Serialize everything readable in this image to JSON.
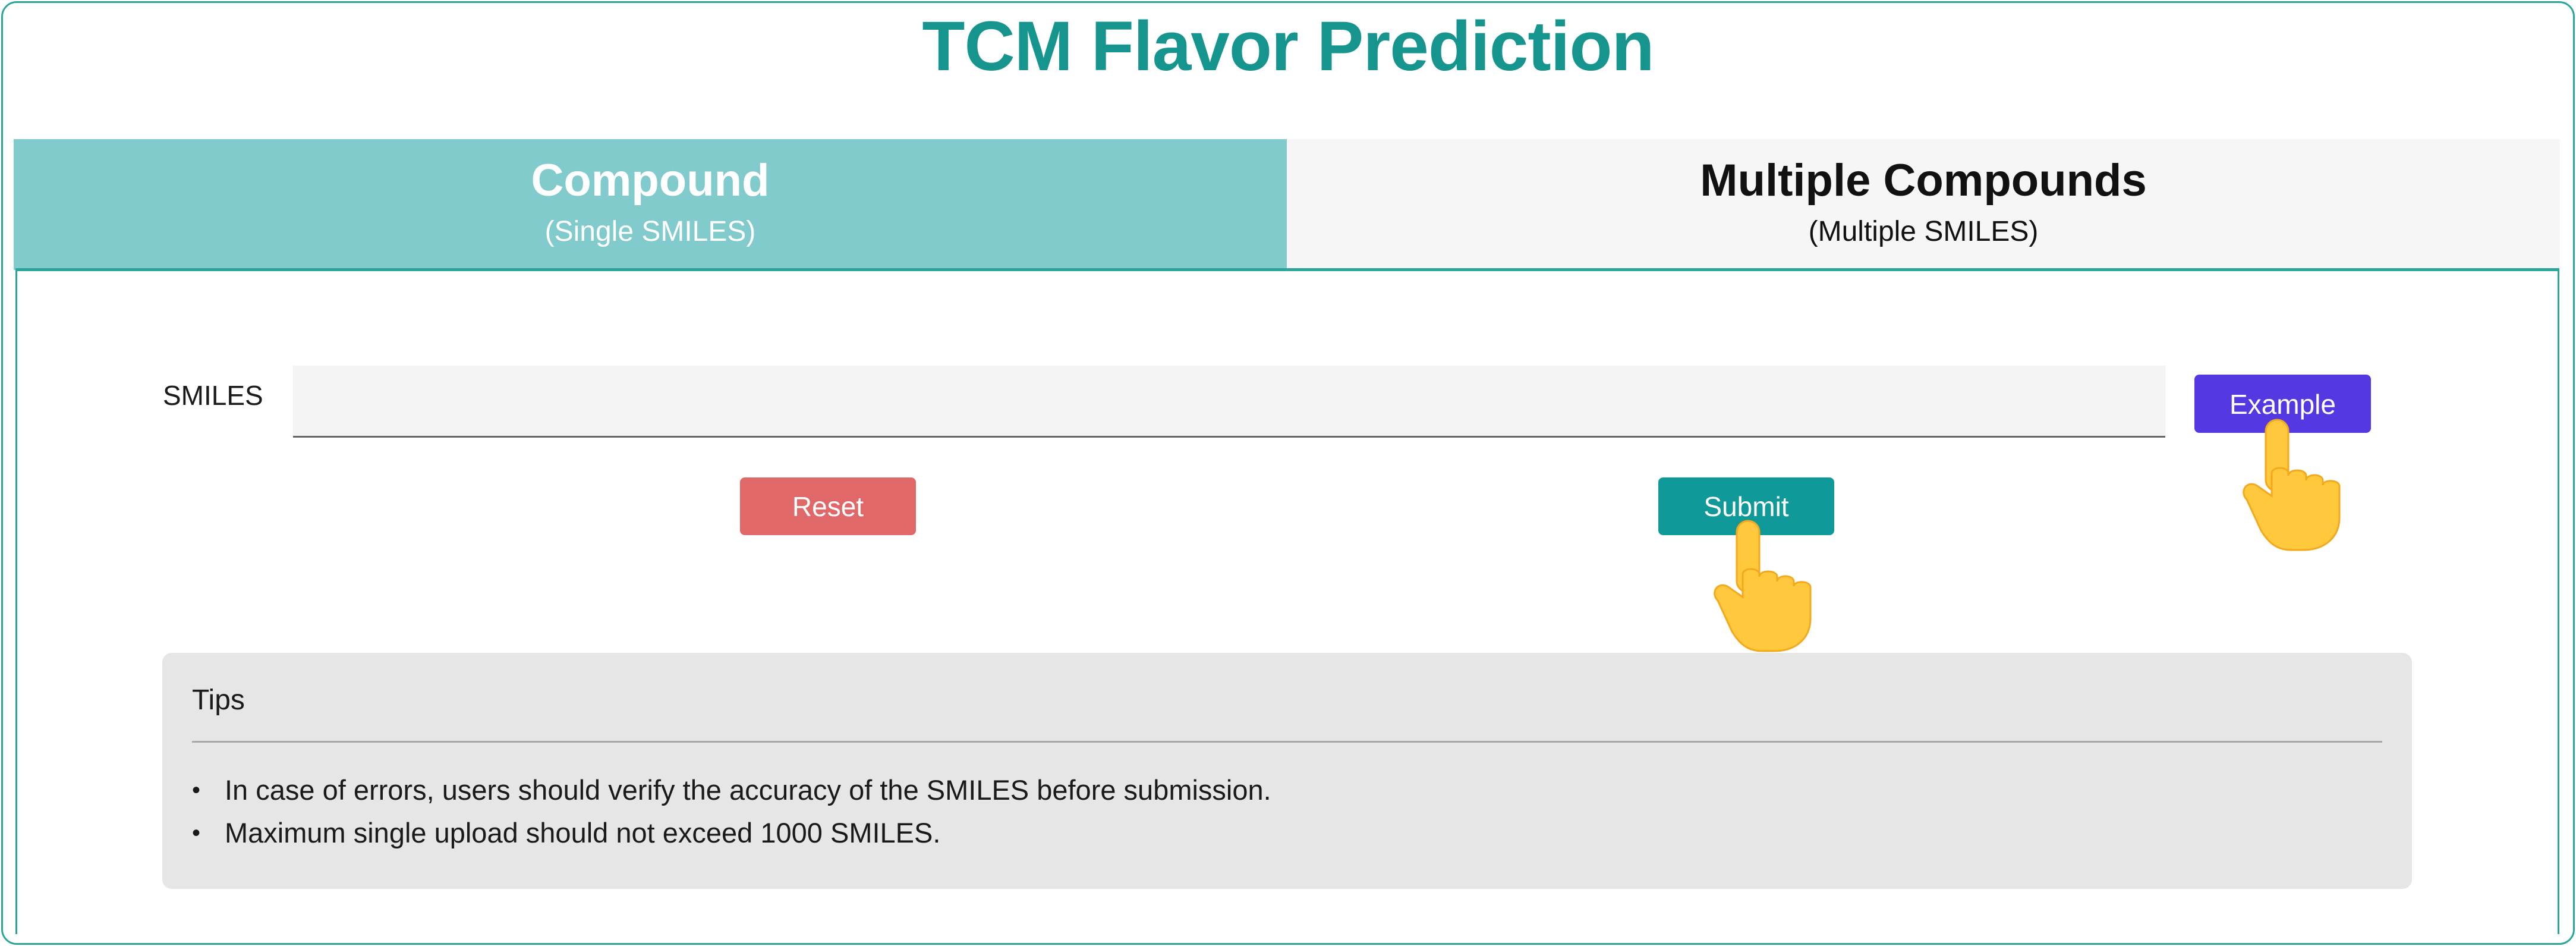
{
  "page": {
    "title": "TCM Flavor Prediction"
  },
  "tabs": [
    {
      "label": "Compound",
      "sublabel": "(Single SMILES)",
      "active": true
    },
    {
      "label": "Multiple Compounds",
      "sublabel": "(Multiple SMILES)",
      "active": false
    }
  ],
  "form": {
    "smiles_label": "SMILES",
    "smiles_value": "",
    "smiles_placeholder": "",
    "example_label": "Example",
    "reset_label": "Reset",
    "submit_label": "Submit"
  },
  "tips": {
    "title": "Tips",
    "items": [
      "In case of errors, users should verify the accuracy of the SMILES before submission.",
      "Maximum single upload should not exceed 1000 SMILES."
    ]
  },
  "icons": {
    "pointer": "pointing-hand-icon"
  },
  "colors": {
    "accent": "#16958f",
    "tab_active": "#82cbcc",
    "example_button": "#5439e3",
    "reset_button": "#e06868",
    "submit_button": "#0f9999",
    "hand": "#ffc83d"
  }
}
